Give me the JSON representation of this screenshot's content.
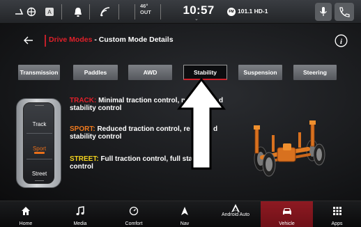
{
  "status_bar": {
    "outside_temp": "46°",
    "outside_label": "OUT",
    "clock": "10:57",
    "radio_badge": "FM",
    "radio_station": "101.1 HD-1"
  },
  "header": {
    "parent": "Drive Modes",
    "separator": " - ",
    "title": "Custom Mode Details"
  },
  "tabs": [
    {
      "label": "Transmission",
      "active": false
    },
    {
      "label": "Paddles",
      "active": false
    },
    {
      "label": "AWD",
      "active": false
    },
    {
      "label": "Stability",
      "active": true
    },
    {
      "label": "Suspension",
      "active": false
    },
    {
      "label": "Steering",
      "active": false
    }
  ],
  "mode_selector": {
    "options": [
      "Track",
      "Sport",
      "Street"
    ],
    "selected": "Sport"
  },
  "descriptions": [
    {
      "mode": "TRACK:",
      "text": " Minimal traction control, m",
      "line2": "stability control",
      "color": "#e0202a"
    },
    {
      "mode": "SPORT:",
      "text": " Reduced traction control, re",
      "line2": "stability control",
      "color": "#f07a1e"
    },
    {
      "mode": "STREET:",
      "text": " Full traction control, full stability",
      "line2": "control",
      "color": "#f2d21e"
    }
  ],
  "partial_letters": {
    "track_tail": "d",
    "sport_tail": "d"
  },
  "nav": [
    {
      "label": "Home",
      "icon": "home-icon",
      "active": false
    },
    {
      "label": "Media",
      "icon": "music-note-icon",
      "active": false
    },
    {
      "label": "Comfort",
      "icon": "comfort-dial-icon",
      "active": false
    },
    {
      "label": "Nav",
      "icon": "navigation-arrow-icon",
      "active": false
    },
    {
      "label": "Android Auto",
      "icon": "android-auto-icon",
      "active": false
    },
    {
      "label": "Vehicle",
      "icon": "car-icon",
      "active": true
    },
    {
      "label": "Apps",
      "icon": "apps-grid-icon",
      "active": false
    }
  ],
  "colors": {
    "accent_red": "#e0202a",
    "track": "#e0202a",
    "sport": "#f07a1e",
    "street": "#f2d21e",
    "active_nav": "#8e1a22"
  }
}
